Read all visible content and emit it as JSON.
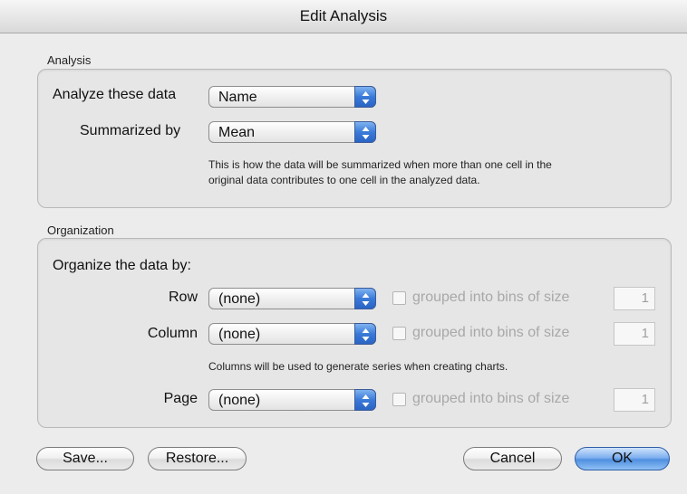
{
  "window": {
    "title": "Edit Analysis"
  },
  "analysis": {
    "group_label": "Analysis",
    "analyze_label": "Analyze these data",
    "analyze_value": "Name",
    "summarize_label": "Summarized by",
    "summarize_value": "Mean",
    "note_line1": "This is how the data will be summarized when more than one cell in the",
    "note_line2": "original data contributes to one cell in the analyzed data."
  },
  "organization": {
    "group_label": "Organization",
    "heading": "Organize the data by:",
    "rows": [
      {
        "label": "Row",
        "value": "(none)",
        "checkbox_label": "grouped into bins of size",
        "bin_size": "1"
      },
      {
        "label": "Column",
        "value": "(none)",
        "checkbox_label": "grouped into bins of size",
        "bin_size": "1"
      },
      {
        "label": "Page",
        "value": "(none)",
        "checkbox_label": "grouped into bins of size",
        "bin_size": "1"
      }
    ],
    "column_note": "Columns will be used to generate series when creating charts."
  },
  "buttons": {
    "save": "Save...",
    "restore": "Restore...",
    "cancel": "Cancel",
    "ok": "OK"
  }
}
